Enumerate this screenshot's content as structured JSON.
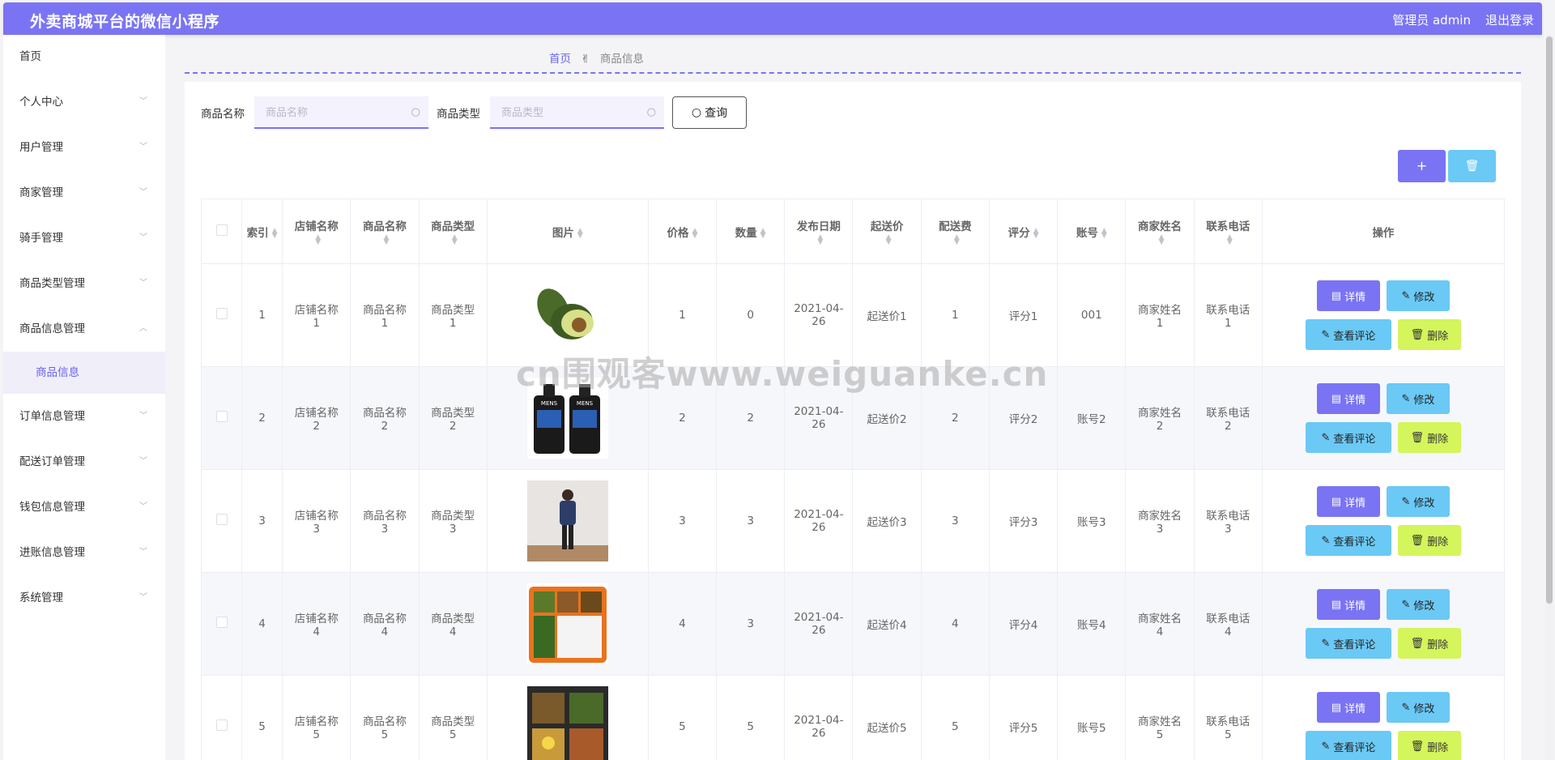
{
  "app": {
    "title": "外卖商城平台的微信小程序",
    "user_label": "管理员 admin",
    "logout_label": "退出登录",
    "accent_color": "#7a74f4"
  },
  "sidebar": {
    "items": [
      {
        "label": "首页",
        "expandable": false
      },
      {
        "label": "个人中心",
        "expandable": true
      },
      {
        "label": "用户管理",
        "expandable": true
      },
      {
        "label": "商家管理",
        "expandable": true
      },
      {
        "label": "骑手管理",
        "expandable": true
      },
      {
        "label": "商品类型管理",
        "expandable": true
      },
      {
        "label": "商品信息管理",
        "expandable": true,
        "expanded": true
      },
      {
        "label": "商品信息",
        "sub": true
      },
      {
        "label": "订单信息管理",
        "expandable": true
      },
      {
        "label": "配送订单管理",
        "expandable": true
      },
      {
        "label": "钱包信息管理",
        "expandable": true
      },
      {
        "label": "进账信息管理",
        "expandable": true
      },
      {
        "label": "系统管理",
        "expandable": true
      }
    ]
  },
  "breadcrumb": {
    "home": "首页",
    "current": "商品信息"
  },
  "search": {
    "name_label": "商品名称",
    "name_placeholder": "商品名称",
    "type_label": "商品类型",
    "type_placeholder": "商品类型",
    "query_label": "查询"
  },
  "toolbar": {
    "add_label": "+",
    "delete_icon": "trash-icon"
  },
  "table": {
    "headers": [
      "索引",
      "店铺名称",
      "商品名称",
      "商品类型",
      "图片",
      "价格",
      "数量",
      "发布日期",
      "起送价",
      "配送费",
      "评分",
      "账号",
      "商家姓名",
      "联系电话",
      "操作"
    ],
    "rows": [
      {
        "index": "1",
        "shop": "店铺名称1",
        "name": "商品名称1",
        "type": "商品类型1",
        "price": "1",
        "qty": "0",
        "date": "2021-04-26",
        "min": "起送价1",
        "fee": "1",
        "score": "评分1",
        "account": "001",
        "merchant": "商家姓名1",
        "phone": "联系电话1"
      },
      {
        "index": "2",
        "shop": "店铺名称2",
        "name": "商品名称2",
        "type": "商品类型2",
        "price": "2",
        "qty": "2",
        "date": "2021-04-26",
        "min": "起送价2",
        "fee": "2",
        "score": "评分2",
        "account": "账号2",
        "merchant": "商家姓名2",
        "phone": "联系电话2"
      },
      {
        "index": "3",
        "shop": "店铺名称3",
        "name": "商品名称3",
        "type": "商品类型3",
        "price": "3",
        "qty": "3",
        "date": "2021-04-26",
        "min": "起送价3",
        "fee": "3",
        "score": "评分3",
        "account": "账号3",
        "merchant": "商家姓名3",
        "phone": "联系电话3"
      },
      {
        "index": "4",
        "shop": "店铺名称4",
        "name": "商品名称4",
        "type": "商品类型4",
        "price": "4",
        "qty": "3",
        "date": "2021-04-26",
        "min": "起送价4",
        "fee": "4",
        "score": "评分4",
        "account": "账号4",
        "merchant": "商家姓名4",
        "phone": "联系电话4"
      },
      {
        "index": "5",
        "shop": "店铺名称5",
        "name": "商品名称5",
        "type": "商品类型5",
        "price": "5",
        "qty": "5",
        "date": "2021-04-26",
        "min": "起送价5",
        "fee": "5",
        "score": "评分5",
        "account": "账号5",
        "merchant": "商家姓名5",
        "phone": "联系电话5"
      }
    ],
    "actions": {
      "detail": "详情",
      "edit": "修改",
      "view_comments": "查看评论",
      "delete": "删除"
    }
  },
  "watermark": "cn围观客www.weiguanke.cn"
}
